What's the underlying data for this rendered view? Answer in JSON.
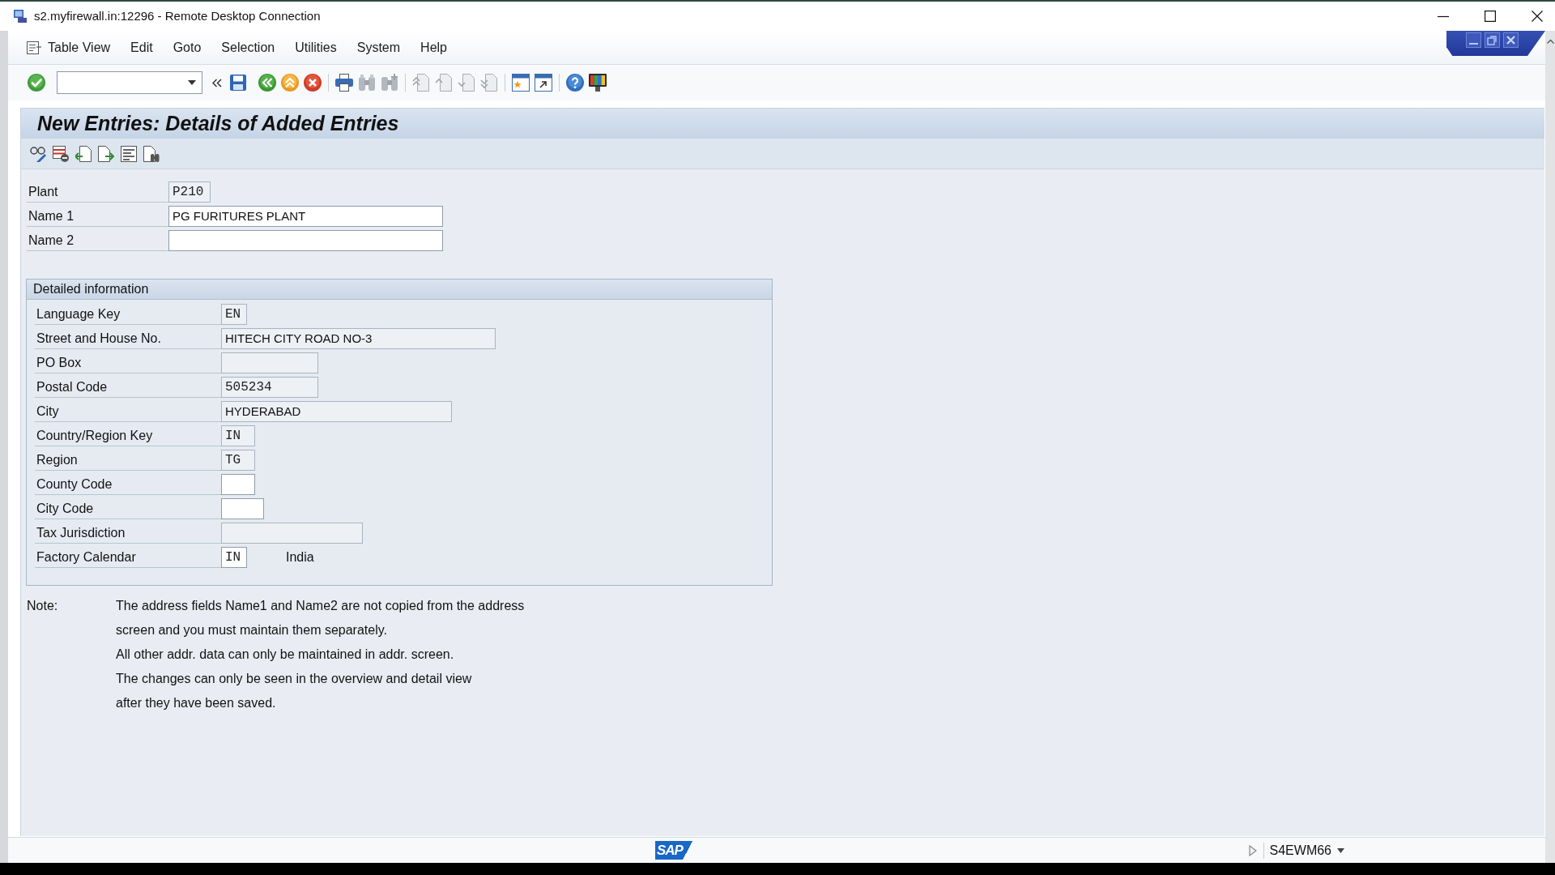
{
  "window": {
    "title": "s2.myfirewall.in:12296 - Remote Desktop Connection"
  },
  "menu_bar": {
    "items": [
      "Table View",
      "Edit",
      "Goto",
      "Selection",
      "Utilities",
      "System",
      "Help"
    ]
  },
  "screen_title": "New Entries: Details of Added Entries",
  "header_fields": [
    {
      "label": "Plant",
      "value": "P210",
      "kind": "code",
      "editable": false
    },
    {
      "label": "Name 1",
      "value": "PG FURITURES PLANT",
      "kind": "text",
      "editable": true
    },
    {
      "label": "Name 2",
      "editable": true
    }
  ],
  "detailed_information": {
    "title": "Detailed information",
    "fields": [
      {
        "label": "Language Key",
        "value": "EN",
        "kind": "code",
        "editable": false
      },
      {
        "label": "Street and House No.",
        "value": "HITECH CITY ROAD NO-3",
        "kind": "text",
        "editable": false
      },
      {
        "label": "PO Box",
        "editable": false
      },
      {
        "label": "Postal Code",
        "value": "505234",
        "kind": "code",
        "editable": false
      },
      {
        "label": "City",
        "value": "HYDERABAD",
        "kind": "text",
        "editable": false
      },
      {
        "label": "Country/Region Key",
        "value": "IN",
        "kind": "code",
        "editable": false
      },
      {
        "label": "Region",
        "value": "TG",
        "kind": "code",
        "editable": false
      },
      {
        "label": "County Code",
        "editable": true
      },
      {
        "label": "City Code",
        "editable": true
      },
      {
        "label": "Tax Jurisdiction",
        "editable": false
      },
      {
        "label": "Factory Calendar",
        "value": "IN",
        "kind": "code",
        "editable": true,
        "description": "India"
      }
    ]
  },
  "note": {
    "label": "Note:",
    "lines": [
      "The address fields Name1 and Name2 are not copied from the address",
      "screen and you must maintain them separately.",
      "All other addr. data can only be maintained in addr. screen.",
      "The changes can only be seen in the overview and detail view",
      "after they have been saved."
    ]
  },
  "status_bar": {
    "logo": "SAP",
    "system": "S4EWM66"
  }
}
